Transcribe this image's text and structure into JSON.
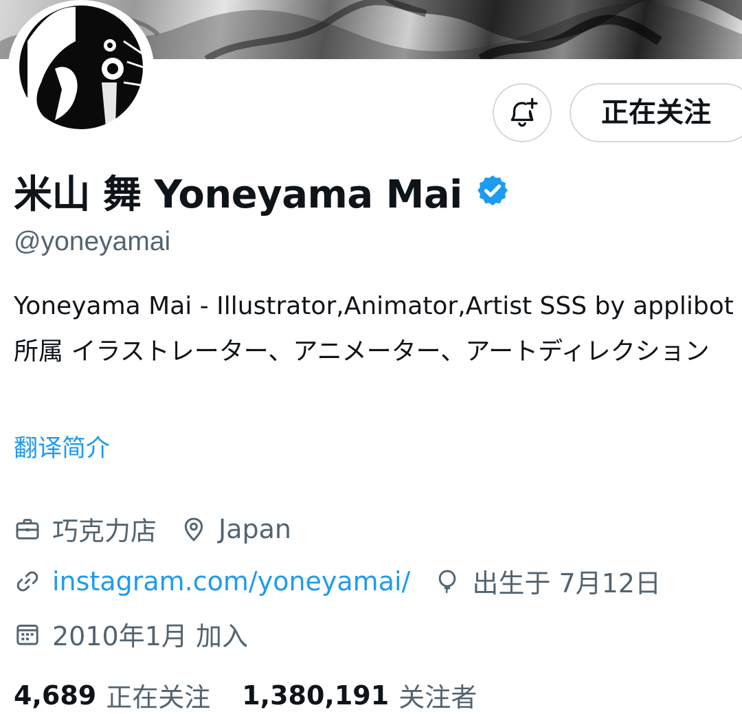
{
  "profile": {
    "display_name": "米山 舞 Yoneyama Mai",
    "handle": "@yoneyamai",
    "bio": "Yoneyama Mai - Illustrator,Animator,Artist SSS by applibot所属 イラストレーター、アニメーター、アートディレクション",
    "translate_label": "翻译简介",
    "verified_color": "#1d9bf0"
  },
  "actions": {
    "notify_icon": "bell-plus-icon",
    "follow_label": "正在关注"
  },
  "meta": {
    "category": "巧克力店",
    "location": "Japan",
    "website": "instagram.com/yoneyamai/",
    "birthday": "出生于 7月12日",
    "joined": "2010年1月 加入"
  },
  "stats": {
    "following_count": "4,689",
    "following_label": "正在关注",
    "followers_count": "1,380,191",
    "followers_label": "关注者"
  },
  "colors": {
    "accent": "#1d9bf0",
    "secondary_text": "#536471",
    "primary_text": "#0f1419",
    "border": "#cfd9de"
  }
}
